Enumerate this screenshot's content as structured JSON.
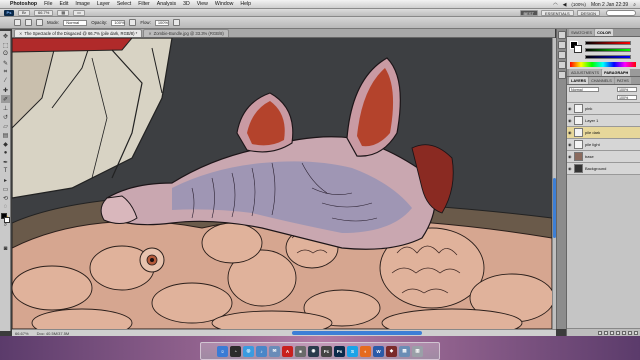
{
  "menubar": {
    "app": "Photoshop",
    "items": [
      "File",
      "Edit",
      "Image",
      "Layer",
      "Select",
      "Filter",
      "Analysis",
      "3D",
      "View",
      "Window",
      "Help"
    ],
    "clock": "Mon 2 Jan  22:39",
    "battery": "(100%)"
  },
  "psbar": {
    "logo": "Ps",
    "zoom": "66.7%",
    "workspaces": [
      "BEST",
      "ESSENTIALS",
      "DESIGN"
    ]
  },
  "options": {
    "mode_label": "Mode:",
    "mode_value": "Normal",
    "opacity_label": "Opacity:",
    "opacity_value": "100%",
    "flow_label": "Flow:",
    "flow_value": "100%"
  },
  "tabs": [
    {
      "label": "The Spectacle of the Disgaced @ 66.7% (pile dark, RGB/8) *",
      "active": true
    },
    {
      "label": "Zombie-Bundle.jpg @ 33.3% (RGB/8)",
      "active": false
    }
  ],
  "status": {
    "zoom": "66.67%",
    "doc": "Doc: 40.5M/37.5M"
  },
  "panels": {
    "color_tabs": [
      "SWATCHES",
      "COLOR"
    ],
    "adjust_tabs": [
      "ADJUSTMENTS",
      "PARAGRAPH"
    ],
    "layer_tabs": [
      "LAYERS",
      "CHANNELS",
      "PATHS"
    ],
    "blend_mode": "Normal",
    "opacity": "100%",
    "fill": "100%",
    "layers": [
      {
        "name": "pink",
        "selected": false,
        "thumb": "white"
      },
      {
        "name": "Layer 1",
        "selected": false,
        "thumb": "white"
      },
      {
        "name": "pile dark",
        "selected": true,
        "thumb": "white"
      },
      {
        "name": "pile light",
        "selected": false,
        "thumb": "white"
      },
      {
        "name": "base",
        "selected": false,
        "thumb": "pic"
      },
      {
        "name": "Background",
        "selected": false,
        "thumb": "dark"
      }
    ]
  },
  "dock": [
    {
      "icon": "finder-icon",
      "color": "#3a7bd5",
      "glyph": "☺"
    },
    {
      "icon": "dashboard-icon",
      "color": "#2b2b2b",
      "glyph": "◔"
    },
    {
      "icon": "safari-icon",
      "color": "#3b9be0",
      "glyph": "◎"
    },
    {
      "icon": "itunes-icon",
      "color": "#4a86c8",
      "glyph": "♪"
    },
    {
      "icon": "mail-icon",
      "color": "#6a8cb8",
      "glyph": "✉"
    },
    {
      "icon": "acrobat-icon",
      "color": "#c8201e",
      "glyph": "A"
    },
    {
      "icon": "app-icon",
      "color": "#6a6a6a",
      "glyph": "■"
    },
    {
      "icon": "steam-icon",
      "color": "#2a3b4c",
      "glyph": "◉"
    },
    {
      "icon": "fontcase-icon",
      "color": "#444",
      "glyph": "Fc"
    },
    {
      "icon": "photoshop-icon",
      "color": "#0b2a4a",
      "glyph": "Ps"
    },
    {
      "icon": "skype-icon",
      "color": "#1aa3e8",
      "glyph": "S"
    },
    {
      "icon": "firefox-icon",
      "color": "#e56b1f",
      "glyph": "◐"
    },
    {
      "icon": "word-icon",
      "color": "#2a5aa8",
      "glyph": "W"
    },
    {
      "icon": "app2-icon",
      "color": "#7a2a2a",
      "glyph": "◆"
    },
    {
      "icon": "documents-icon",
      "color": "#6b8db5",
      "glyph": "▤"
    },
    {
      "icon": "trash-icon",
      "color": "#9aa0a8",
      "glyph": "▥"
    }
  ]
}
